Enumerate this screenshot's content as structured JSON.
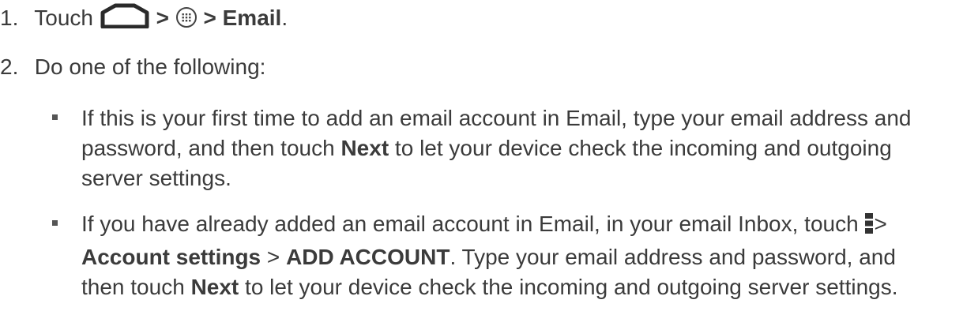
{
  "step1": {
    "number": "1.",
    "lead": "Touch",
    "sep1": ">",
    "sep2": ">",
    "target": "Email",
    "end": ".",
    "home_icon": "home-icon",
    "apps_icon": "apps-icon"
  },
  "step2": {
    "number": "2.",
    "text": "Do one of the following:"
  },
  "bullet1": {
    "line1": "If this is your first time to add an email account in Email, type your email address and",
    "line2_pre": "password, and then touch ",
    "line2_bold": "Next",
    "line2_post": " to let your device check the incoming and outgoing",
    "line3": "server settings."
  },
  "bullet2": {
    "line1": "If you have already added an email account in Email, in your email Inbox, touch",
    "line1_sep": ">",
    "menu_icon": "menu-icon",
    "line2_bold1": "Account settings",
    "line2_sep": " > ",
    "line2_bold2": "ADD ACCOUNT",
    "line2_post": ". Type your email address and password, and",
    "line3_pre": "then touch ",
    "line3_bold": "Next",
    "line3_post": " to let your device check the incoming and outgoing server settings."
  }
}
